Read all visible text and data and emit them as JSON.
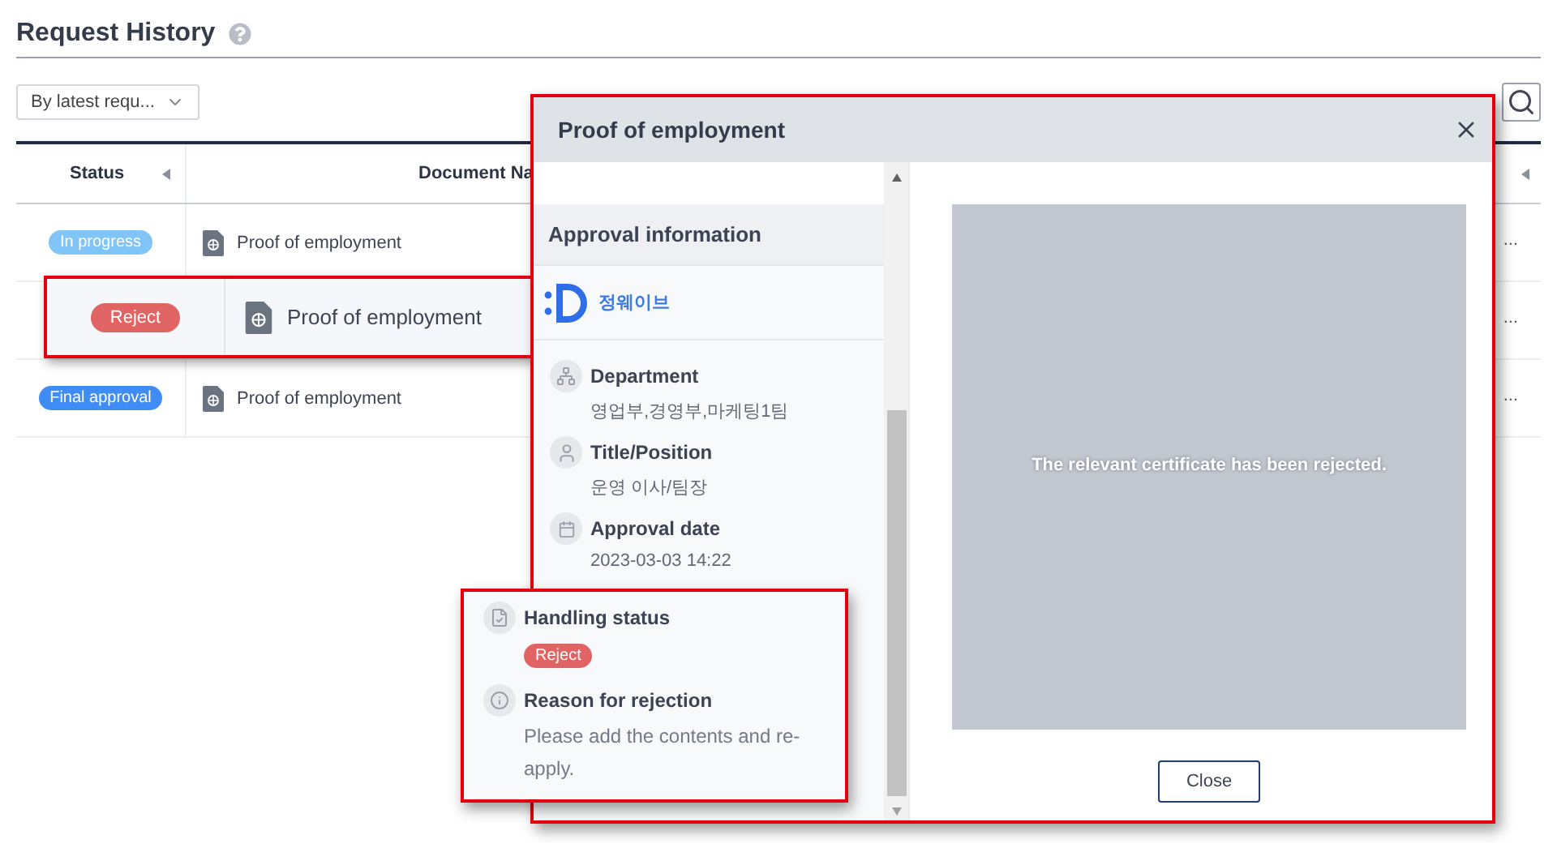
{
  "page": {
    "title": "Request History"
  },
  "sort_dropdown": {
    "value": "By latest requ..."
  },
  "table": {
    "columns": [
      "Status",
      "Document Na"
    ],
    "rows": [
      {
        "status": "In progress",
        "color": "#80c4f8",
        "document": "Proof of employment",
        "column_3": "...",
        "highlighted": false
      },
      {
        "status": "Reject",
        "color": "#e06464",
        "document": "Proof of employment",
        "column_3": "...",
        "highlighted": true
      },
      {
        "status": "Final approval",
        "color": "#3f8cf4",
        "document": "Proof of employment",
        "column_3": "...",
        "highlighted": false
      }
    ]
  },
  "modal": {
    "title": "Proof of employment",
    "section_title": "Approval information",
    "approver": "정웨이브",
    "fields": [
      {
        "kind": "department",
        "label": "Department",
        "value": "영업부,경영부,마케팅1팀"
      },
      {
        "kind": "person",
        "label": "Title/Position",
        "value": "운영 이사/팀장"
      },
      {
        "kind": "date",
        "label": "Approval date",
        "value": "2023-03-03 14:22"
      }
    ],
    "preview_message": "The relevant certificate has been rejected.",
    "close_button": "Close"
  },
  "callout": {
    "handling_label": "Handling status",
    "handling_status": {
      "label": "Reject",
      "color": "#e06464"
    },
    "reason_label": "Reason for rejection",
    "reason": "Please add the contents and re-apply."
  }
}
